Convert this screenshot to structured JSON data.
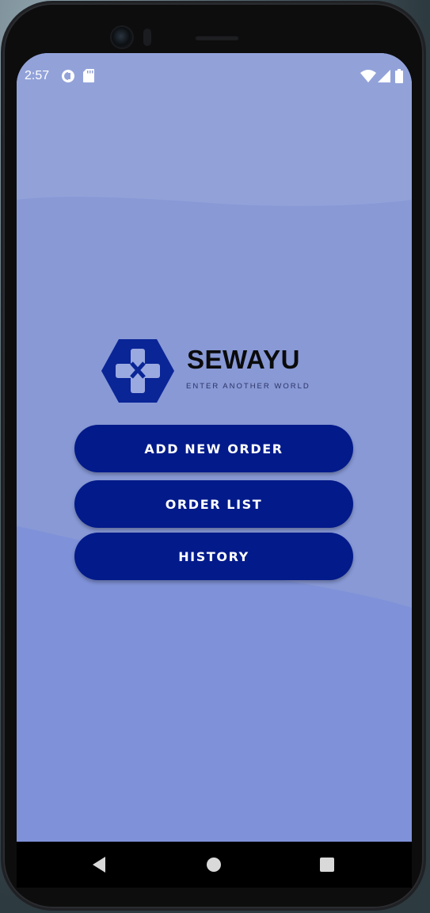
{
  "status_bar": {
    "time": "2:57",
    "left_icons": [
      "sync-icon",
      "sd-card-icon"
    ],
    "right_icons": [
      "wifi-icon",
      "signal-icon",
      "battery-icon"
    ]
  },
  "logo": {
    "title": "SEWAYU",
    "tagline": "ENTER ANOTHER WORLD",
    "icon": "gamepad-hexagon-icon",
    "color": "#0a2596"
  },
  "buttons": {
    "add_new_order": "ADD NEW ORDER",
    "order_list": "ORDER LIST",
    "history": "HISTORY"
  },
  "nav_bar": {
    "items": [
      "back-icon",
      "home-icon",
      "recents-icon"
    ]
  },
  "colors": {
    "background_top": "#92a2d9",
    "background_mid": "#8899d6",
    "background_bottom": "#7f91d8",
    "button": "#021a8a",
    "button_text": "#ffffff"
  }
}
